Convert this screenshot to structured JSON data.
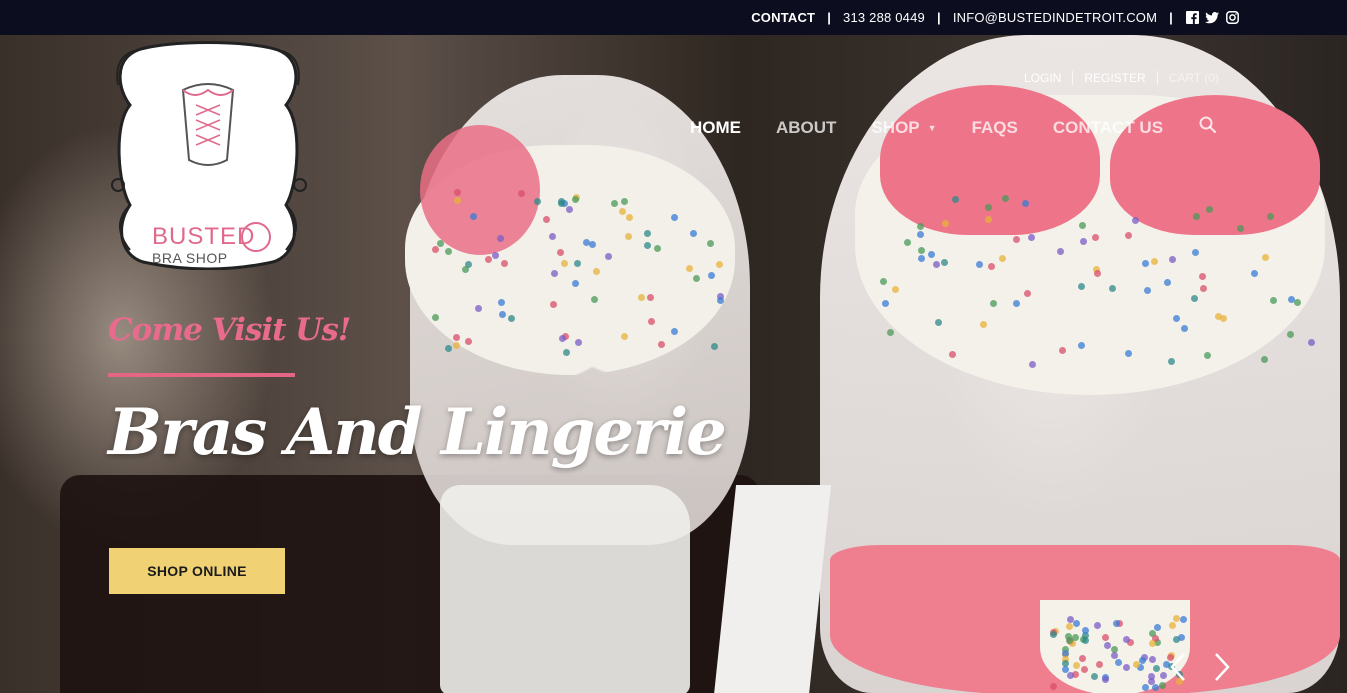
{
  "topbar": {
    "contact_label": "CONTACT",
    "phone": "313 288 0449",
    "email": "INFO@BUSTEDINDETROIT.COM",
    "social_icons": [
      "facebook-icon",
      "twitter-icon",
      "instagram-icon"
    ]
  },
  "logo": {
    "line1": "BUSTED",
    "line2": "BRA SHOP"
  },
  "account": {
    "login": "LOGIN",
    "register": "REGISTER",
    "cart": "CART (0)"
  },
  "nav": {
    "items": [
      {
        "label": "HOME"
      },
      {
        "label": "ABOUT"
      },
      {
        "label": "SHOP"
      },
      {
        "label": "FAQS"
      },
      {
        "label": "CONTACT US"
      }
    ],
    "search_icon": "search-icon"
  },
  "slide": {
    "tagline": "Come Visit Us!",
    "headline": "Bras And Lingerie",
    "button": "SHOP ONLINE"
  },
  "colors": {
    "topbar_bg": "#0c0e1f",
    "accent_pink": "#e86b8e",
    "button_yellow": "#f0d173"
  }
}
